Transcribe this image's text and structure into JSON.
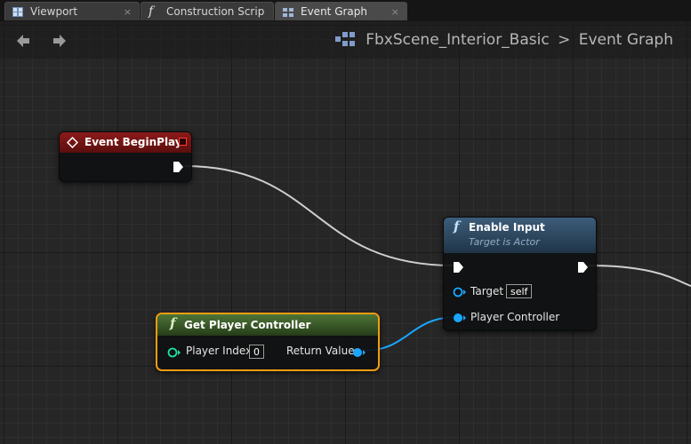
{
  "tabs": [
    {
      "label": "Viewport",
      "icon": "viewport-icon",
      "close": "×"
    },
    {
      "label": "Construction Scrip",
      "icon": "function-icon",
      "close": "×"
    },
    {
      "label": "Event Graph",
      "icon": "event-graph-icon",
      "close": "×",
      "active": true
    }
  ],
  "toolbar": {
    "back": "back-arrow-icon",
    "forward": "forward-arrow-icon"
  },
  "breadcrumb": {
    "blueprint": "FbxScene_Interior_Basic",
    "separator": ">",
    "graph": "Event Graph"
  },
  "nodes": {
    "event_begin_play": {
      "title": "Event BeginPlay",
      "color": "#7a1414"
    },
    "enable_input": {
      "title": "Enable Input",
      "subtitle": "Target is Actor",
      "pins": {
        "target": "Target",
        "target_value": "self",
        "player_controller": "Player Controller"
      },
      "color": "#2e4c66"
    },
    "get_player_controller": {
      "title": "Get Player Controller",
      "pins": {
        "player_index": "Player Index",
        "player_index_value": "0",
        "return_value": "Return Value"
      },
      "color": "#3a5a2a"
    }
  },
  "colors": {
    "object_pin": "#1aa6ff",
    "exec_wire": "#cfcfcf",
    "int_pin": "#1fe0a8",
    "selection": "#f39c12"
  }
}
